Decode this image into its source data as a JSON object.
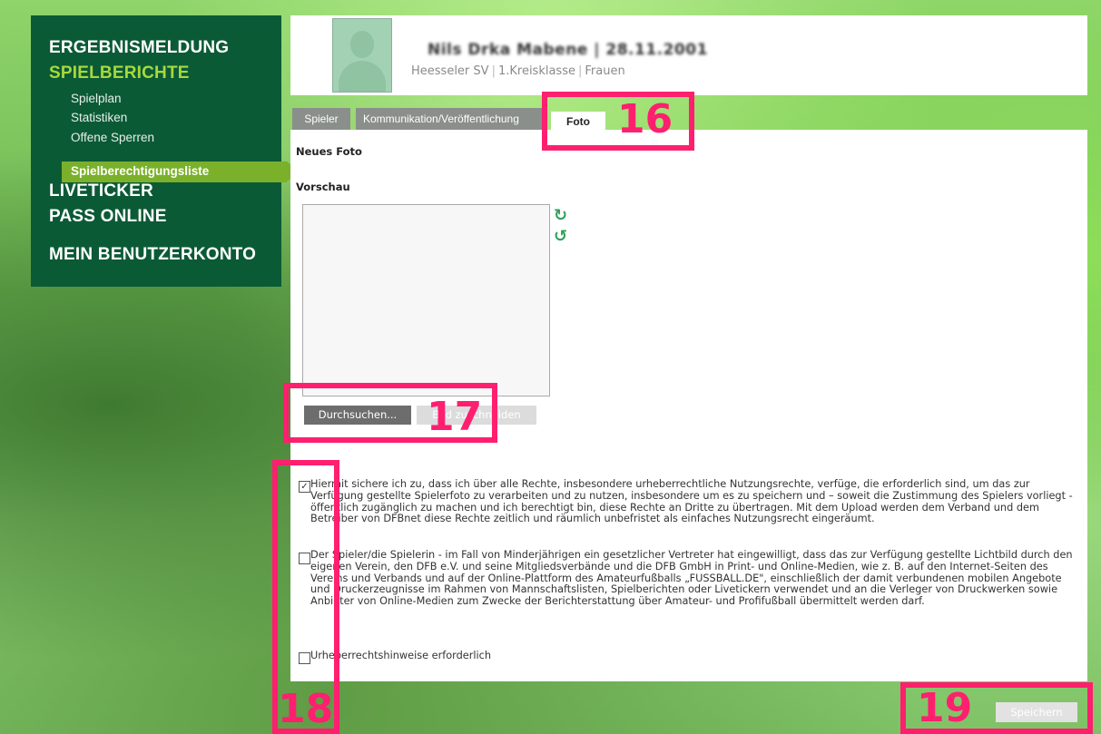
{
  "nav": {
    "heading1": "ERGEBNISMELDUNG",
    "heading2": "SPIELBERICHTE",
    "sub_items": [
      "Spielplan",
      "Statistiken",
      "Offene Sperren",
      "Spielberechtigungsliste"
    ],
    "heading3": "LIVETICKER",
    "heading4": "PASS ONLINE",
    "heading5": "MEIN BENUTZERKONTO"
  },
  "header": {
    "player_name": "Nils Drka Mabene | 28.11.2001",
    "club": "Heesseler SV",
    "league": "1.Kreisklasse",
    "team": "Frauen"
  },
  "tabs": [
    "Spieler",
    "Kommunikation/Veröffentlichung",
    "Foto"
  ],
  "foto": {
    "new_photo_label": "Neues Foto",
    "preview_label": "Vorschau",
    "browse_button": "Durchsuchen...",
    "crop_button": "Bild zuschneiden",
    "rotate_cw_icon": "rotate-cw-icon",
    "rotate_ccw_icon": "rotate-ccw-icon"
  },
  "consents": [
    {
      "checked": true,
      "text": "Hiermit sichere ich zu, dass ich über alle Rechte, insbesondere urheberrechtliche Nutzungsrechte, verfüge, die erforderlich sind, um das zur Verfügung gestellte Spielerfoto zu verarbeiten und zu nutzen, insbesondere um es zu speichern und – soweit die Zustimmung des Spielers vorliegt - öffentlich zugänglich zu machen und ich berechtigt bin, diese Rechte an Dritte zu übertragen. Mit dem Upload werden dem Verband und dem Betreiber von DFBnet diese Rechte zeitlich und räumlich unbefristet als einfaches Nutzungsrecht eingeräumt."
    },
    {
      "checked": false,
      "text": "Der Spieler/die Spielerin - im Fall von Minderjährigen ein gesetzlicher Vertreter hat eingewilligt, dass das zur Verfügung gestellte Lichtbild durch den eigenen Verein, den DFB e.V. und seine Mitgliedsverbände und die DFB GmbH in Print- und Online-Medien, wie z. B. auf den Internet-Seiten des Vereins und Verbands und auf der Online-Plattform des Amateurfußballs „FUSSBALL.DE\", einschließlich der damit verbundenen mobilen Angebote und Druckerzeugnisse im Rahmen von Mannschaftslisten, Spielberichten oder Livetickern verwendet und an die Verleger von Druckwerken sowie Anbieter von Online-Medien zum Zwecke der Berichterstattung über Amateur- und Profifußball übermittelt werden darf."
    },
    {
      "checked": false,
      "text": "Urheberrechtshinweise erforderlich"
    }
  ],
  "save_button": "Speichern",
  "annotations": [
    "16",
    "17",
    "18",
    "19"
  ],
  "colors": {
    "nav_bg": "#0b5a36",
    "nav_active": "#a7d93c",
    "annotation": "#ff1f6f"
  }
}
